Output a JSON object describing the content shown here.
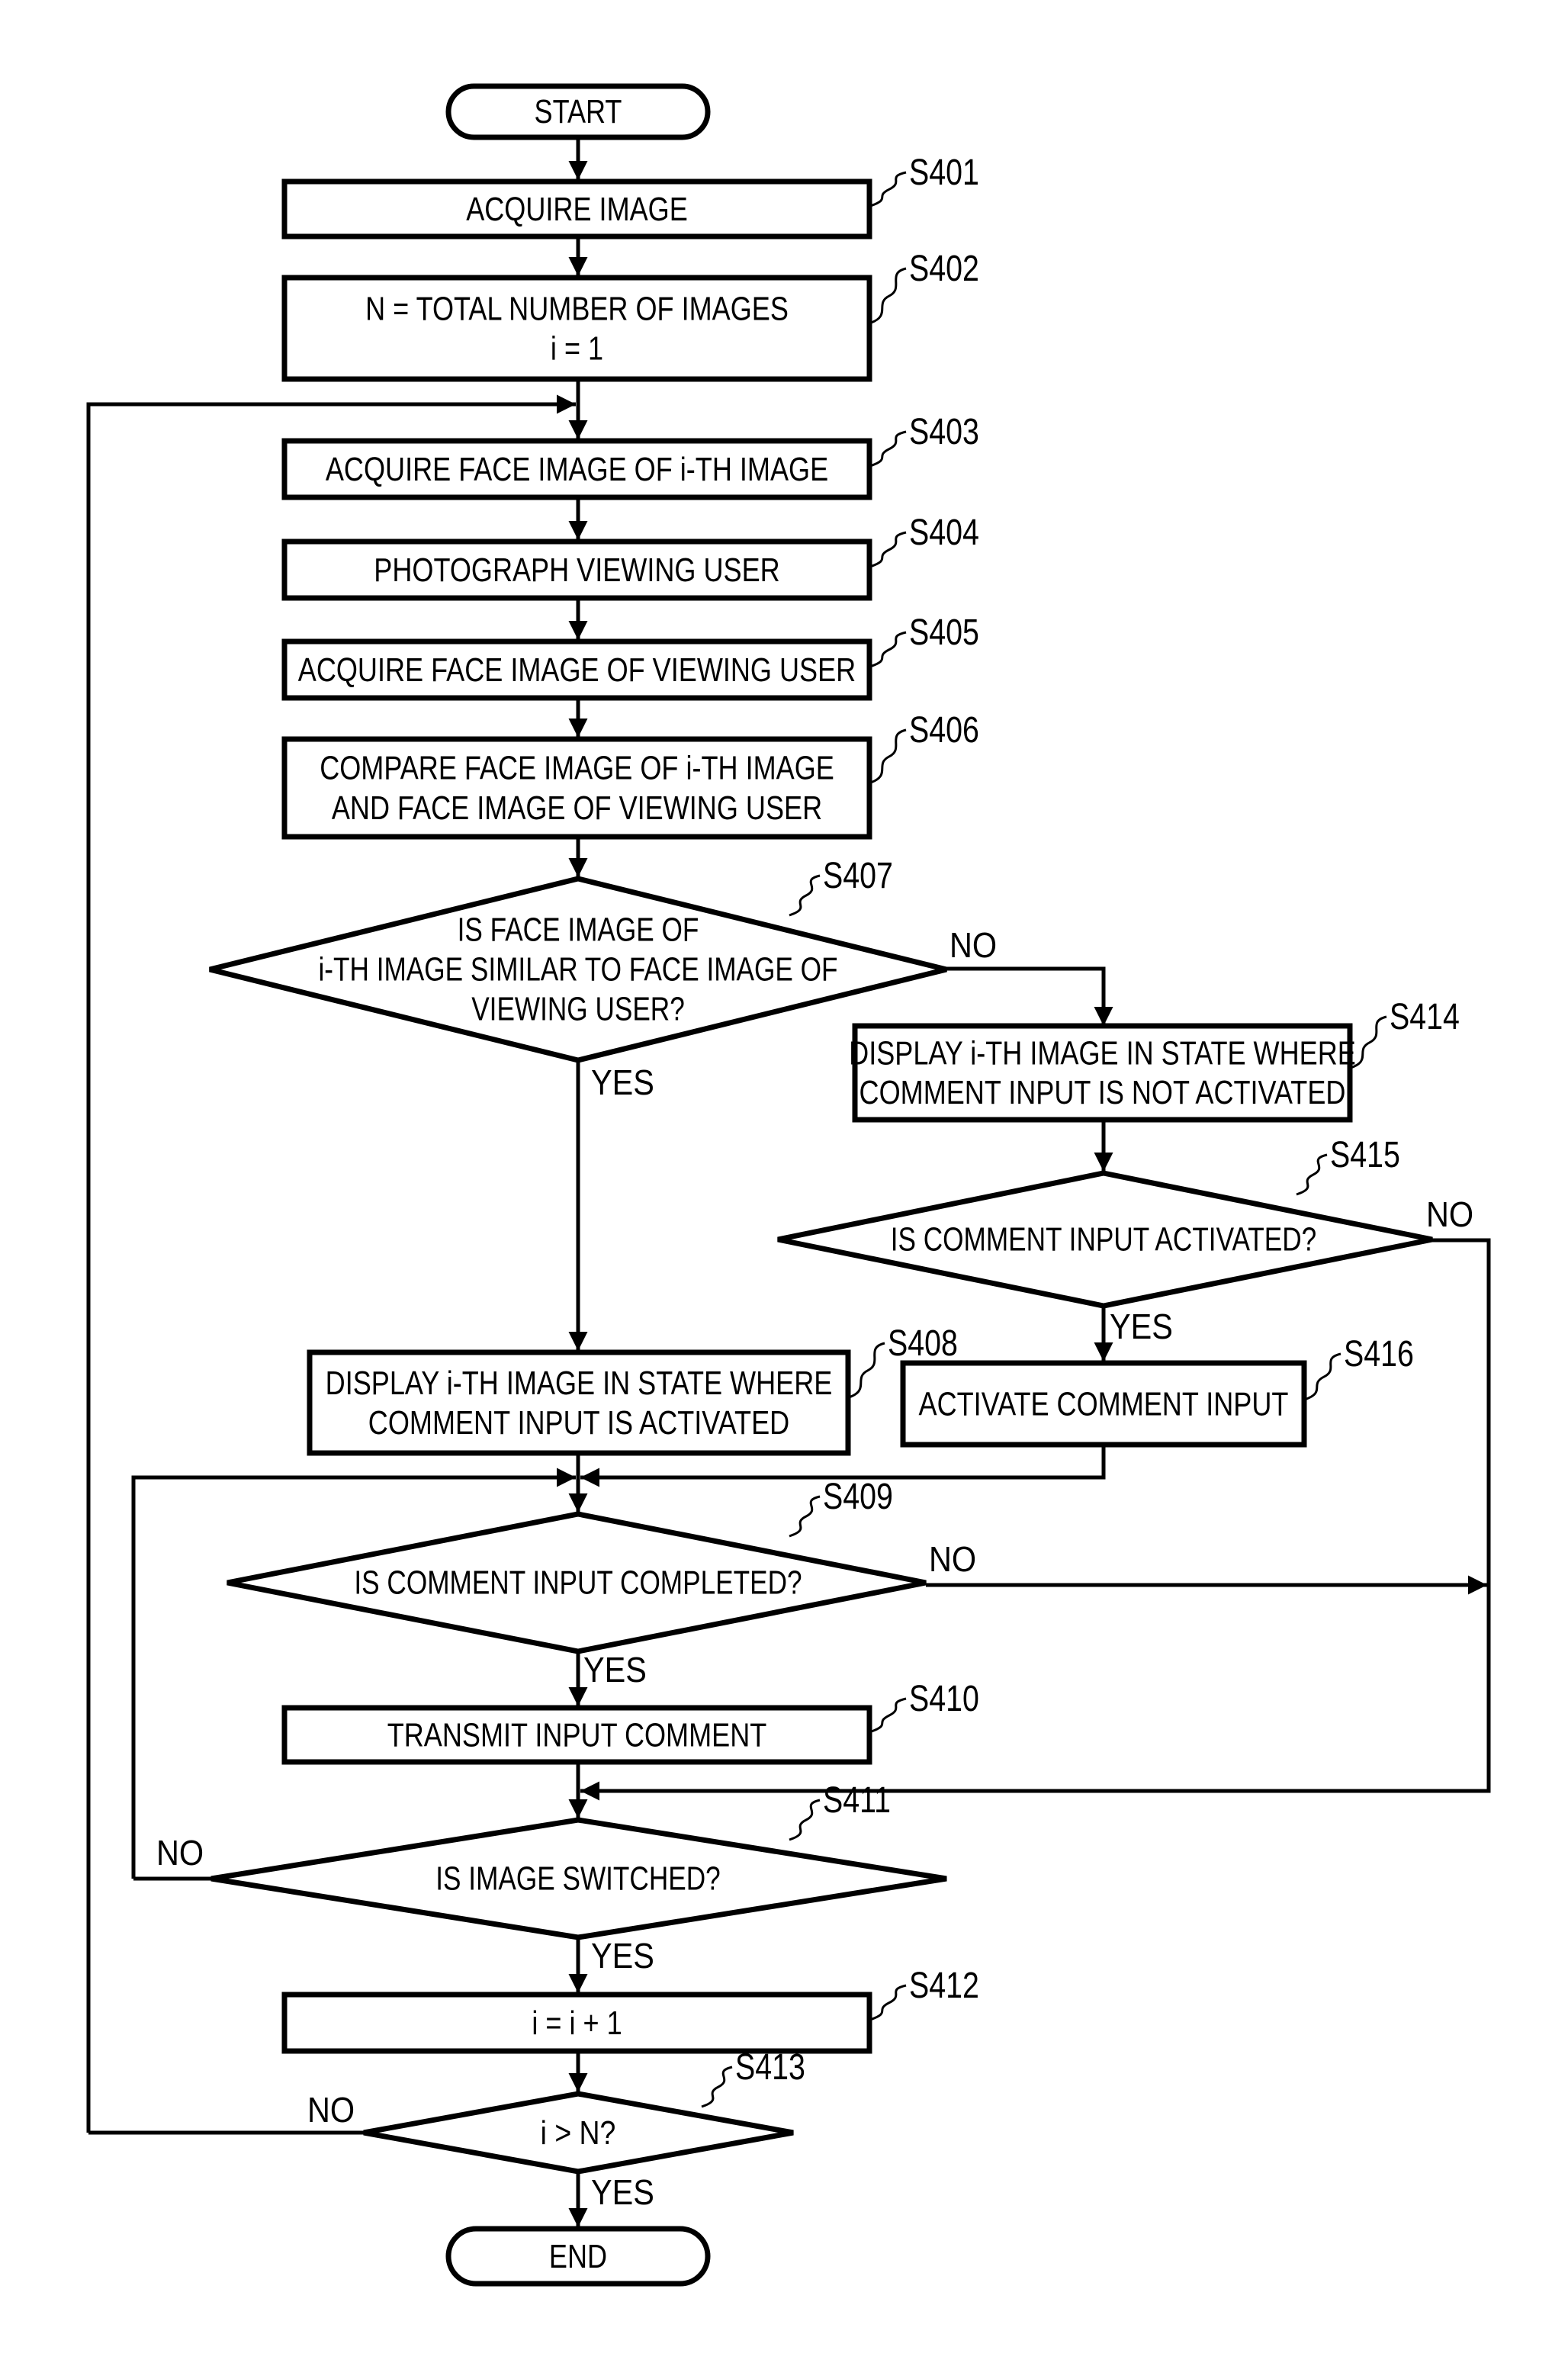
{
  "figure": {
    "colors": {
      "stroke": "#000000",
      "background": "#ffffff"
    },
    "terminals": {
      "start": "START",
      "end": "END"
    },
    "steps": {
      "S401": {
        "id": "S401",
        "lines": [
          "ACQUIRE IMAGE"
        ]
      },
      "S402": {
        "id": "S402",
        "lines": [
          "N = TOTAL NUMBER OF IMAGES",
          "i = 1"
        ]
      },
      "S403": {
        "id": "S403",
        "lines": [
          "ACQUIRE FACE IMAGE OF i-TH IMAGE"
        ]
      },
      "S404": {
        "id": "S404",
        "lines": [
          "PHOTOGRAPH VIEWING USER"
        ]
      },
      "S405": {
        "id": "S405",
        "lines": [
          "ACQUIRE FACE IMAGE OF VIEWING USER"
        ]
      },
      "S406": {
        "id": "S406",
        "lines": [
          "COMPARE FACE IMAGE OF i-TH IMAGE",
          "AND FACE IMAGE OF VIEWING USER"
        ]
      },
      "S407": {
        "id": "S407",
        "lines": [
          "IS FACE IMAGE OF",
          "i-TH IMAGE SIMILAR TO FACE IMAGE OF",
          "VIEWING USER?"
        ]
      },
      "S408": {
        "id": "S408",
        "lines": [
          "DISPLAY i-TH IMAGE IN STATE WHERE",
          "COMMENT INPUT IS ACTIVATED"
        ]
      },
      "S409": {
        "id": "S409",
        "lines": [
          "IS COMMENT INPUT COMPLETED?"
        ]
      },
      "S410": {
        "id": "S410",
        "lines": [
          "TRANSMIT INPUT COMMENT"
        ]
      },
      "S411": {
        "id": "S411",
        "lines": [
          "IS IMAGE SWITCHED?"
        ]
      },
      "S412": {
        "id": "S412",
        "lines": [
          "i = i + 1"
        ]
      },
      "S413": {
        "id": "S413",
        "lines": [
          "i > N?"
        ]
      },
      "S414": {
        "id": "S414",
        "lines": [
          "DISPLAY i-TH IMAGE IN STATE WHERE",
          "COMMENT INPUT IS NOT ACTIVATED"
        ]
      },
      "S415": {
        "id": "S415",
        "lines": [
          "IS COMMENT INPUT ACTIVATED?"
        ]
      },
      "S416": {
        "id": "S416",
        "lines": [
          "ACTIVATE COMMENT INPUT"
        ]
      }
    },
    "branches": {
      "yes": "YES",
      "no": "NO"
    }
  }
}
